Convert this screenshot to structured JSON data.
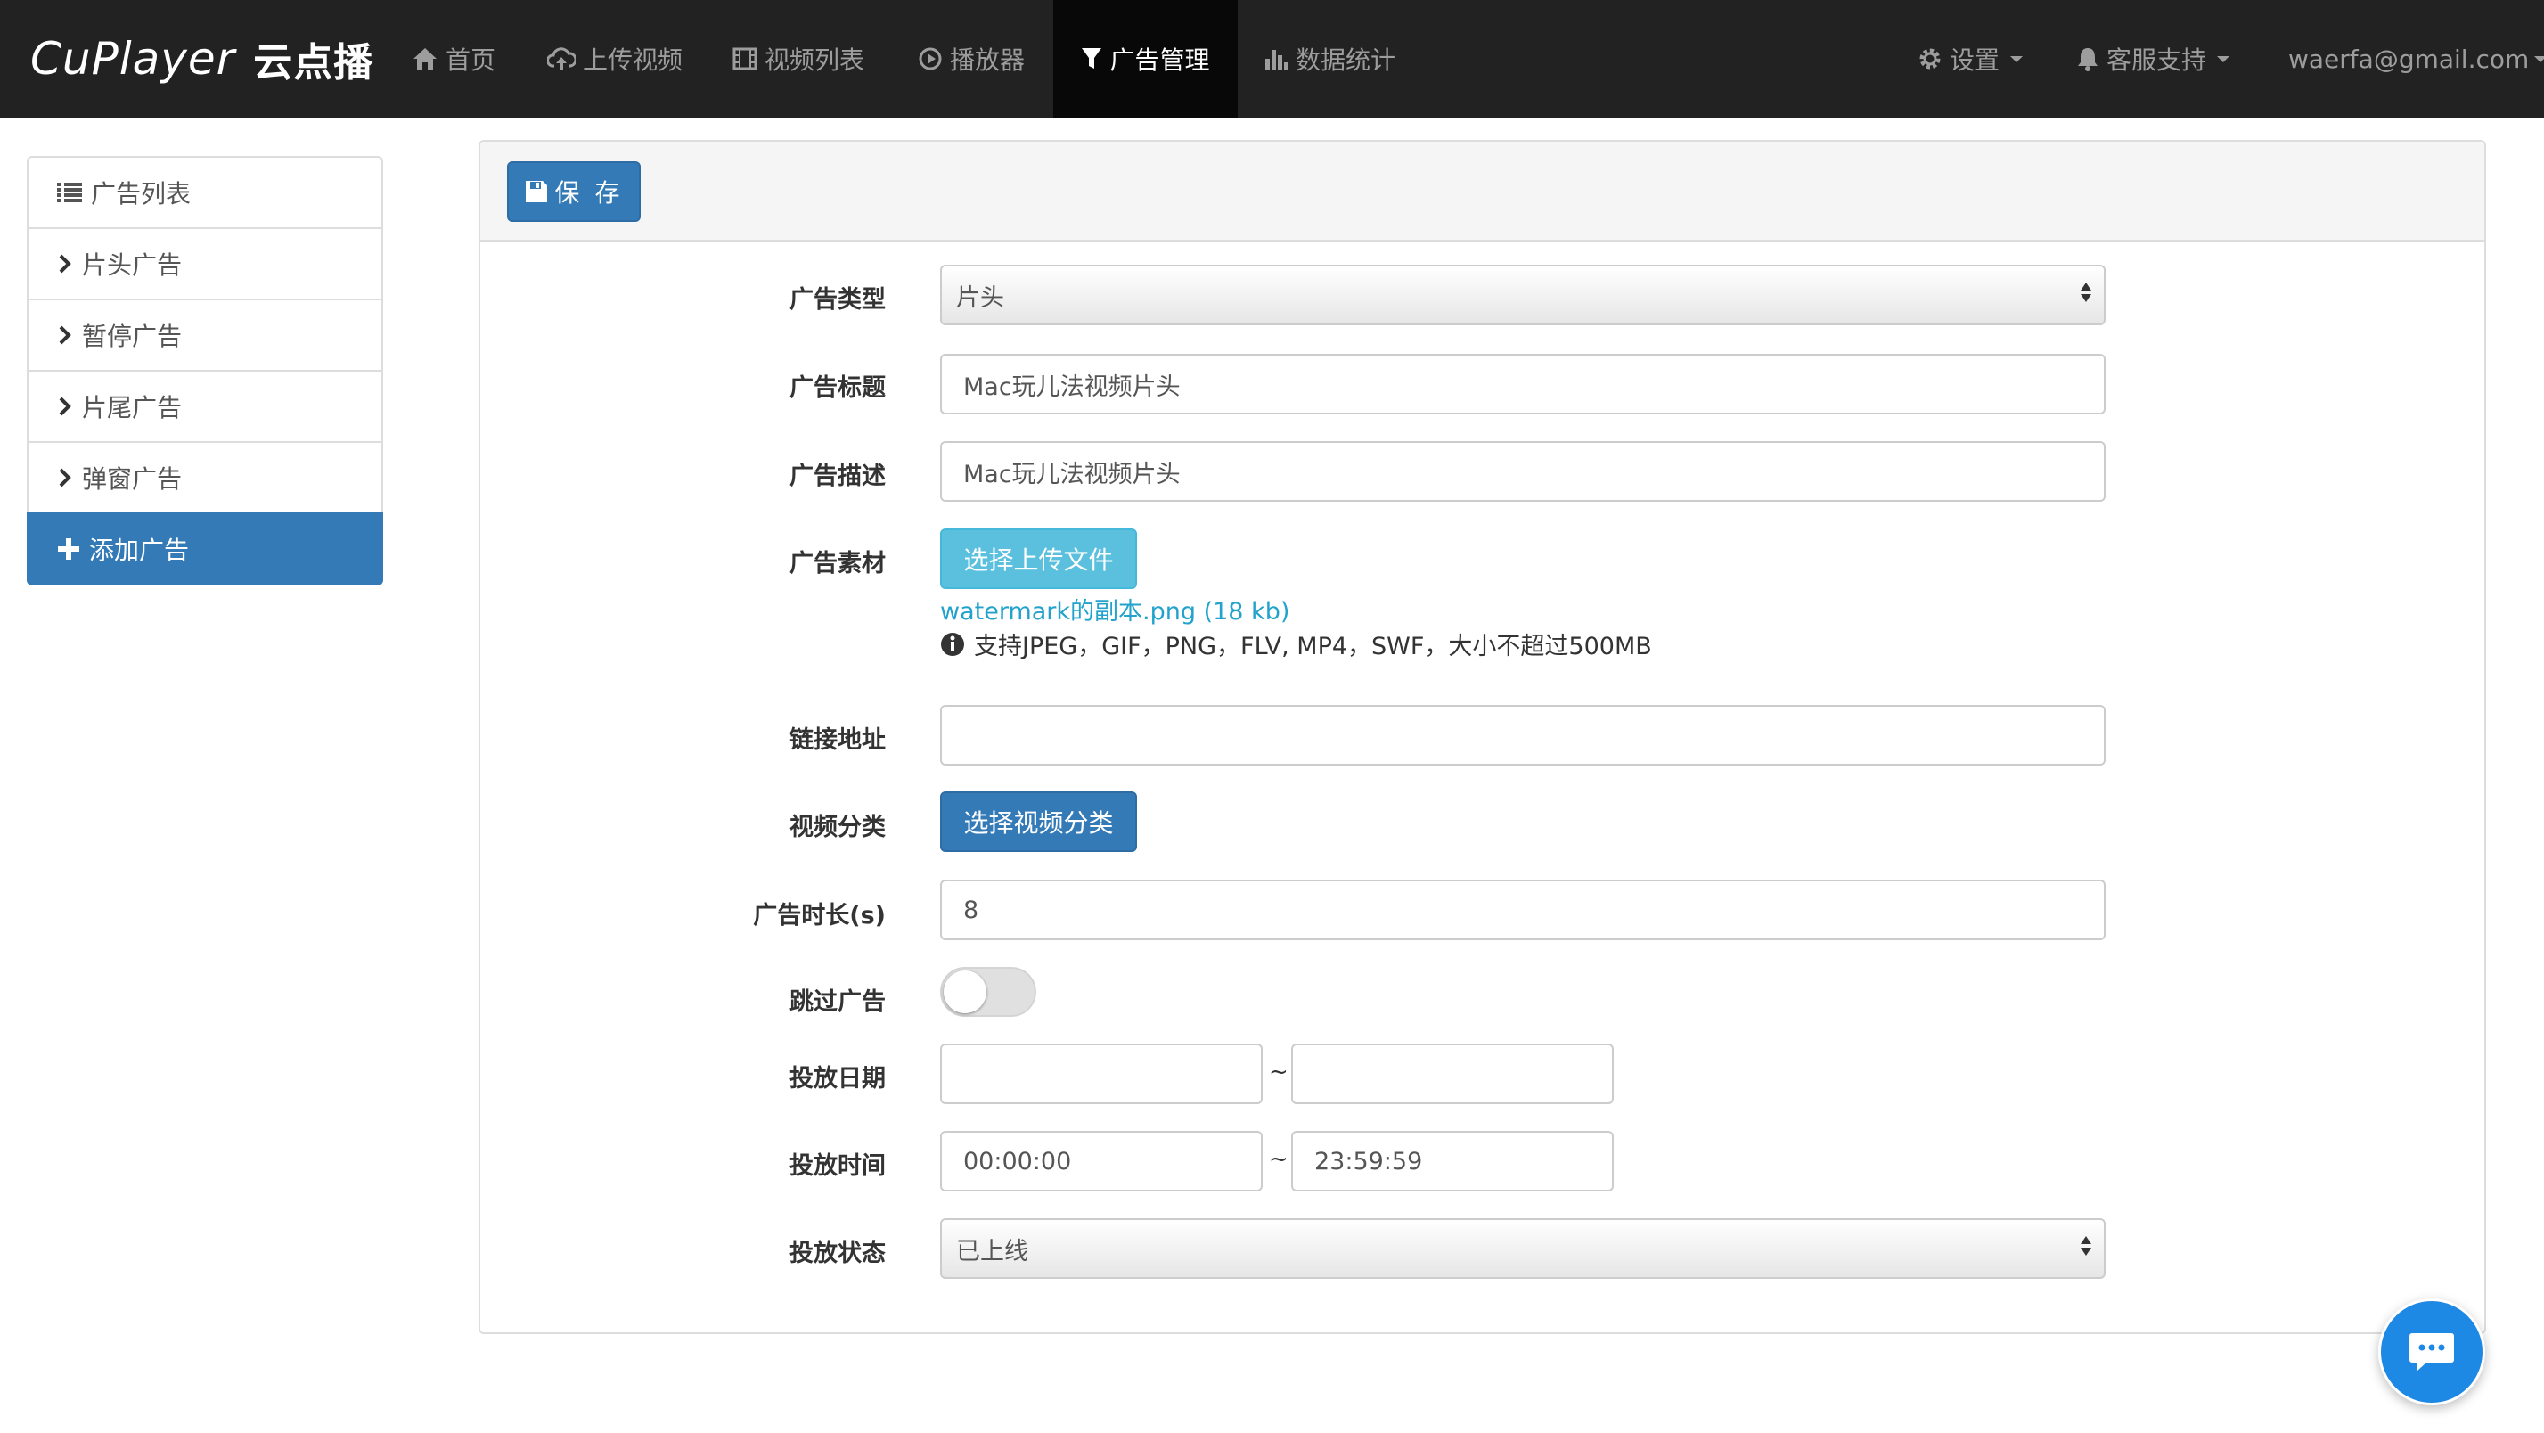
{
  "brand": {
    "name": "CuPlayer",
    "suffix": "云点播"
  },
  "nav": {
    "home": "首页",
    "upload": "上传视频",
    "video_list": "视频列表",
    "player": "播放器",
    "ads": "广告管理",
    "stats": "数据统计",
    "settings": "设置",
    "support": "客服支持",
    "user": "waerfa@gmail.com"
  },
  "sidebar": {
    "items": [
      {
        "label": "广告列表"
      },
      {
        "label": "片头广告"
      },
      {
        "label": "暂停广告"
      },
      {
        "label": "片尾广告"
      },
      {
        "label": "弹窗广告"
      },
      {
        "label": "添加广告"
      }
    ]
  },
  "toolbar": {
    "save_label": "保 存"
  },
  "form": {
    "type": {
      "label": "广告类型",
      "value": "片头"
    },
    "title": {
      "label": "广告标题",
      "value": "Mac玩儿法视频片头"
    },
    "desc": {
      "label": "广告描述",
      "value": "Mac玩儿法视频片头"
    },
    "material": {
      "label": "广告素材",
      "button": "选择上传文件",
      "file": "watermark的副本.png (18 kb)",
      "help": "支持JPEG，GIF，PNG，FLV, MP4，SWF，大小不超过500MB"
    },
    "link": {
      "label": "链接地址",
      "value": ""
    },
    "category": {
      "label": "视频分类",
      "button": "选择视频分类"
    },
    "duration": {
      "label": "广告时长(s)",
      "value": "8"
    },
    "skip": {
      "label": "跳过广告",
      "on": false
    },
    "date": {
      "label": "投放日期",
      "from": "",
      "to": "",
      "sep": "~"
    },
    "time": {
      "label": "投放时间",
      "from": "00:00:00",
      "to": "23:59:59",
      "sep": "~"
    },
    "status": {
      "label": "投放状态",
      "value": "已上线"
    }
  },
  "colors": {
    "navbar": "#222222",
    "primary": "#337ab7",
    "info": "#5bc0de",
    "chat": "#1e88e5"
  }
}
